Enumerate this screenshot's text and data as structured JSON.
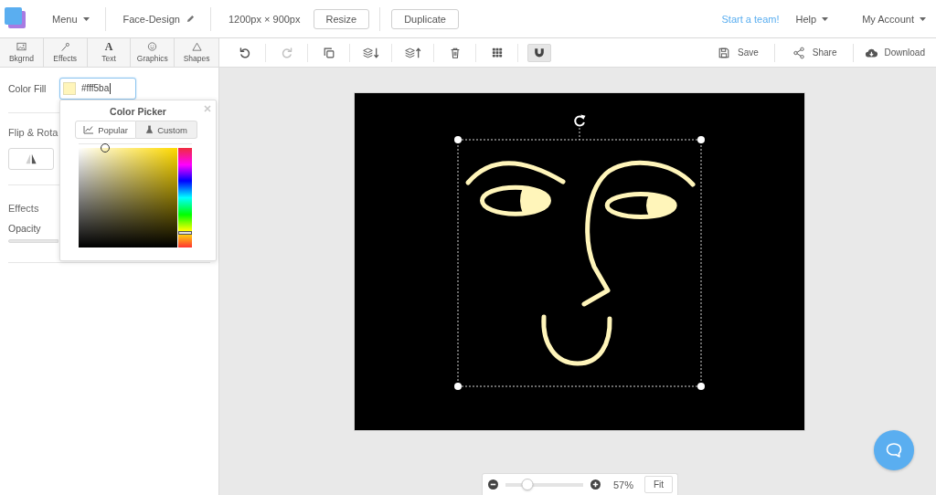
{
  "top_bar": {
    "menu": "Menu",
    "document_title": "Face-Design",
    "canvas_size": "1200px × 900px",
    "buttons": [
      "Resize",
      "Duplicate"
    ],
    "team_link": "Start a team!",
    "help_menu": "Help",
    "account_menu": "My Account"
  },
  "side_panel": {
    "tabs": [
      {
        "label": "Bkgrnd"
      },
      {
        "label": "Effects"
      },
      {
        "label": "Text",
        "glyph": "A"
      },
      {
        "label": "Graphics"
      },
      {
        "label": "Shapes"
      }
    ],
    "color_fill": {
      "label": "Color Fill",
      "value": "#fff5ba"
    },
    "flip_rotate": {
      "heading": "Flip & Rota"
    },
    "effects": {
      "heading": "Effects",
      "opacity_label": "Opacity"
    }
  },
  "color_picker": {
    "title": "Color Picker",
    "tabs": [
      {
        "label": "Popular",
        "selected": false
      },
      {
        "label": "Custom",
        "selected": true
      }
    ]
  },
  "toolbar": {
    "tools": [
      {
        "disabled": false
      },
      {
        "disabled": true
      },
      {
        "disabled": false
      },
      {
        "disabled": false
      },
      {
        "disabled": false
      },
      {
        "disabled": false
      }
    ],
    "toggles": [
      {
        "on": false
      },
      {
        "on": true
      }
    ],
    "actions": [
      "Save",
      "Share",
      "Download"
    ]
  },
  "canvas": {
    "objects": [
      {
        "selected": true
      }
    ]
  },
  "zoom": {
    "level": 0.28,
    "reading": "57%",
    "fit_button": "Fit"
  }
}
